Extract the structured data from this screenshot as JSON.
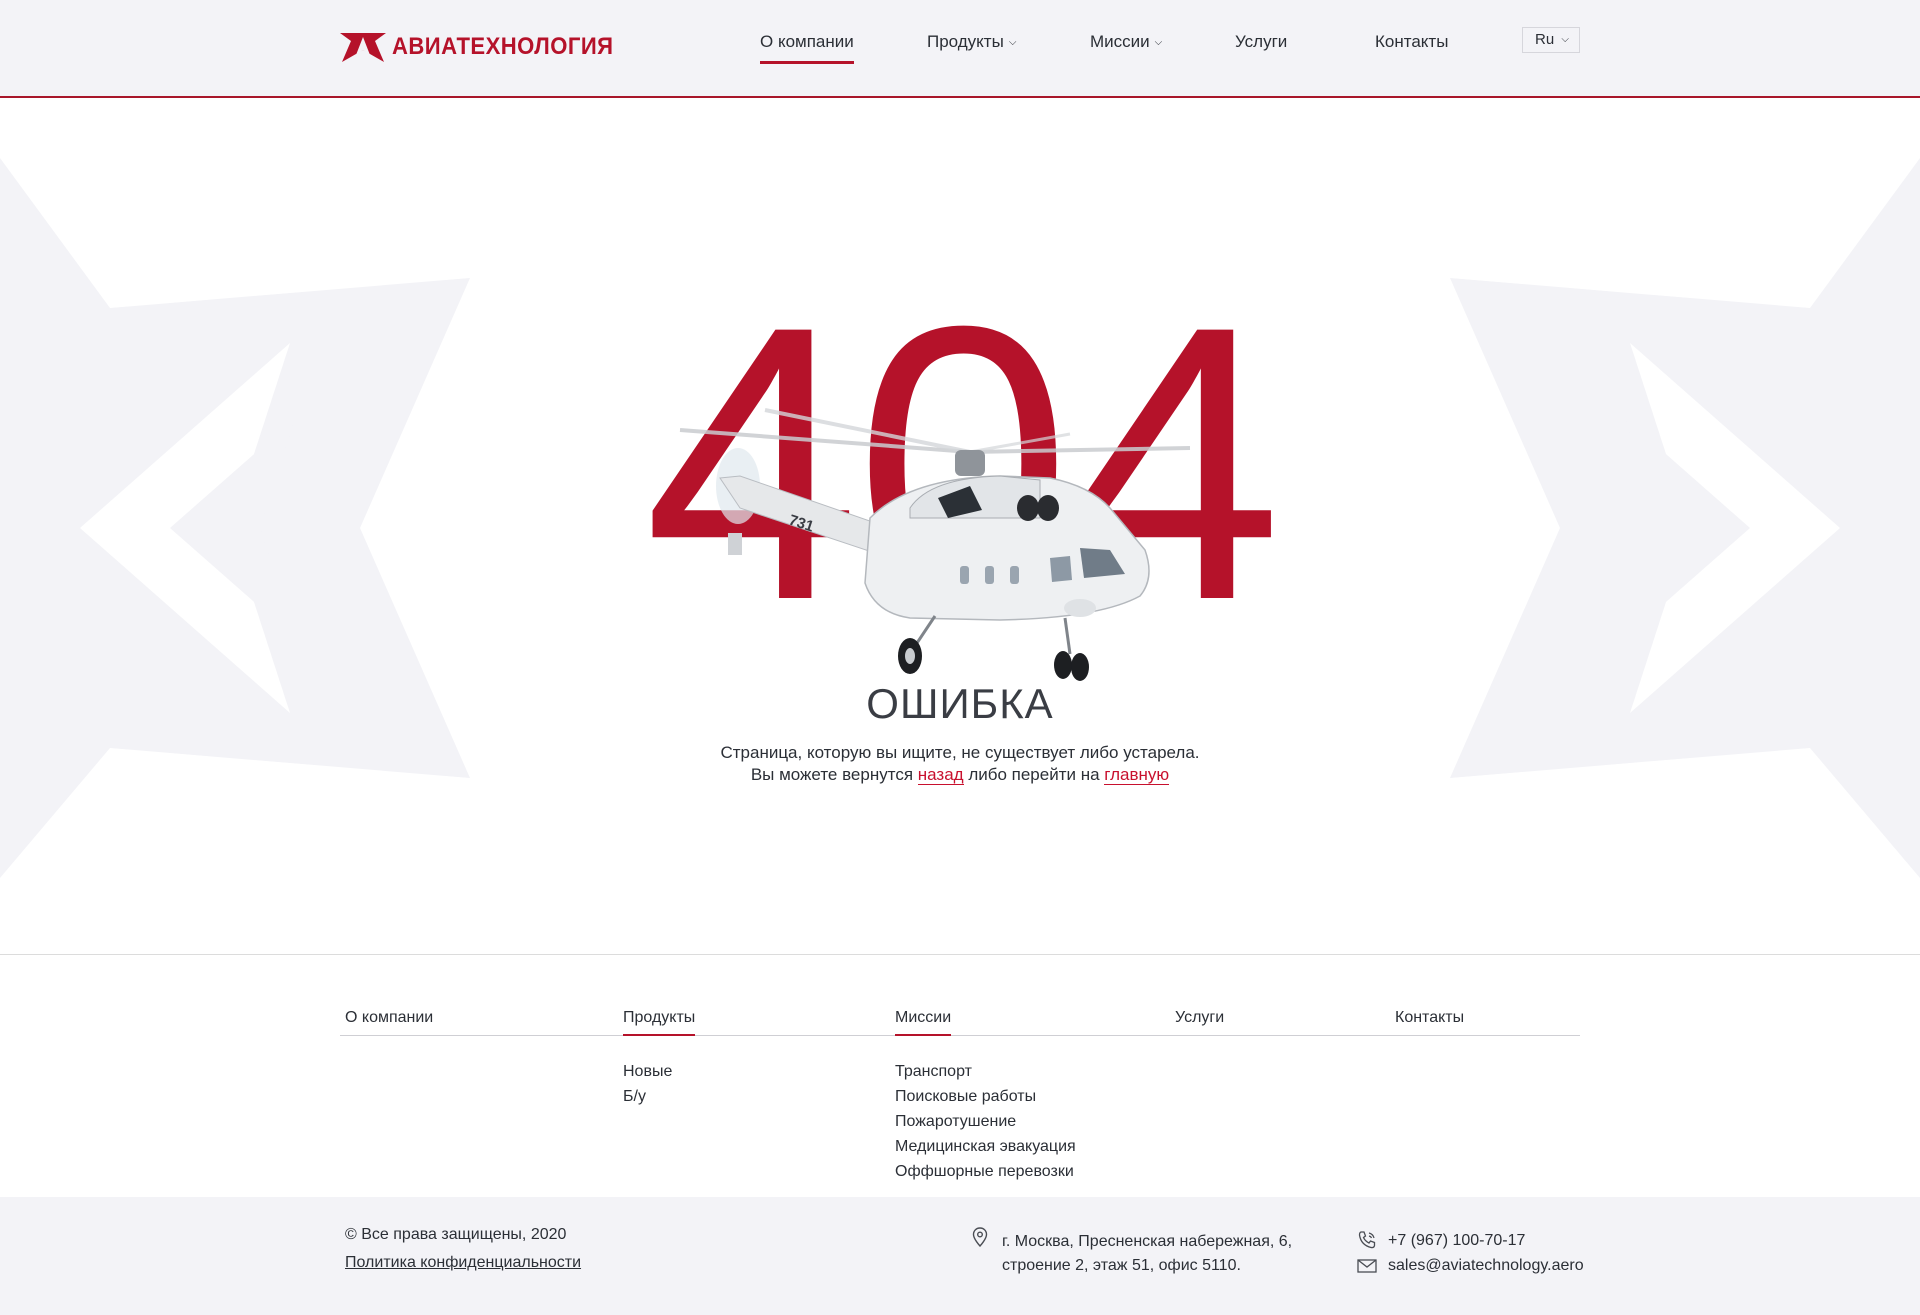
{
  "header": {
    "logo_text": "АВИАТЕХНОЛОГИЯ",
    "nav": [
      {
        "label": "О компании",
        "active": true,
        "dropdown": false
      },
      {
        "label": "Продукты",
        "active": false,
        "dropdown": true
      },
      {
        "label": "Миссии",
        "active": false,
        "dropdown": true
      },
      {
        "label": "Услуги",
        "active": false,
        "dropdown": false
      },
      {
        "label": "Контакты",
        "active": false,
        "dropdown": false
      }
    ],
    "lang": "Ru"
  },
  "error": {
    "code": "404",
    "title": "ОШИБКА",
    "line1": "Страница, которую вы ищите, не существует либо устарела.",
    "line2_prefix": "Вы можете вернутся ",
    "back_link": "назад",
    "line2_middle": " либо перейти на ",
    "home_link": "главную",
    "helicopter_number": "731"
  },
  "footer_nav": [
    {
      "title": "О компании",
      "active": false,
      "items": []
    },
    {
      "title": "Продукты",
      "active": true,
      "items": [
        "Новые",
        "Б/у"
      ]
    },
    {
      "title": "Миссии",
      "active": true,
      "items": [
        "Транспорт",
        "Поисковые работы",
        "Пожаротушение",
        "Медицинская эвакуация",
        "Оффшорные перевозки"
      ]
    },
    {
      "title": "Услуги",
      "active": false,
      "items": []
    },
    {
      "title": "Контакты",
      "active": false,
      "items": []
    }
  ],
  "bottom": {
    "copyright": "© Все права защищены, 2020",
    "policy": "Политика конфиденциальности",
    "address_line1": "г. Москва, Пресненская набережная, 6,",
    "address_line2": "строение 2, этаж 51, офис 5110.",
    "phone": "+7 (967) 100-70-17",
    "email": "sales@aviatechnology.aero"
  },
  "colors": {
    "brand_red": "#b5122a",
    "header_bg": "#f3f3f7",
    "text": "#2b2f36"
  }
}
